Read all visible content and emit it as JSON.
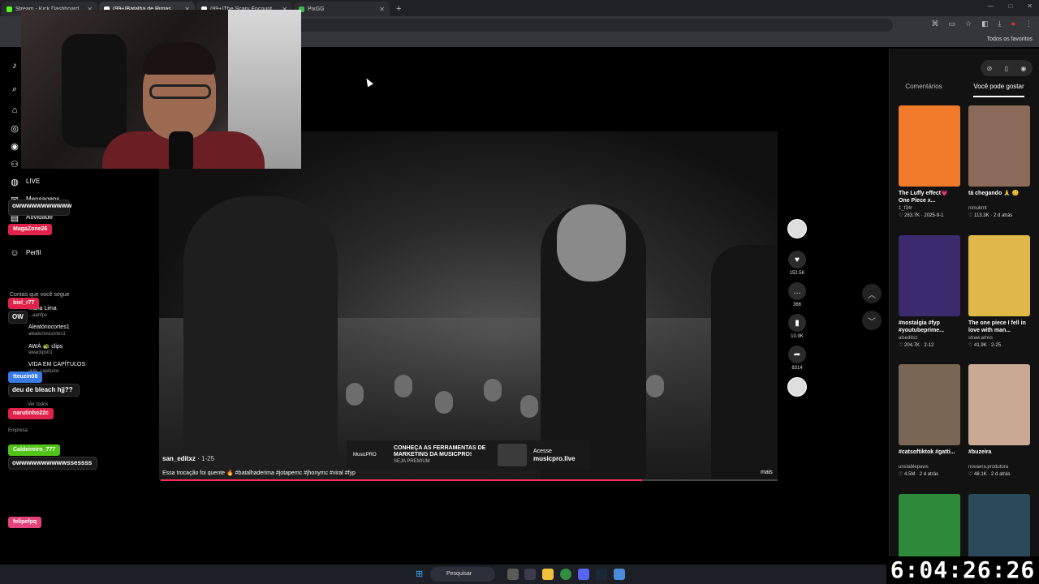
{
  "browser": {
    "tabs": [
      {
        "label": "Stream - Kick Dashboard",
        "color": "#53fc18"
      },
      {
        "label": "(99+)Batalha de Rimas Qu...",
        "color": "#ffffff"
      },
      {
        "label": "(99+)The Scary Encounter with...",
        "color": "#ffffff"
      },
      {
        "label": "PixGG",
        "color": "#3fb950"
      }
    ],
    "new_tab": "+",
    "bookmarks_all": "Todos os favoritos"
  },
  "nav": {
    "live": "LIVE",
    "mensagens": "Mensagens",
    "atividade": "Atividade",
    "perfil": "Perfil",
    "following_header": "Contas que você segue",
    "following": [
      {
        "name": "...ana Lima",
        "handle": "...aanfps"
      },
      {
        "name": "Aleatóriocortes1",
        "handle": "aleatorioscortes1"
      },
      {
        "name": "AWÁ 🐢 clips",
        "handle": "awaclips01"
      },
      {
        "name": "VIDA EM CAPÍTULOS",
        "handle": "vida_capitulos"
      }
    ],
    "see_all": "Ver todos",
    "empresa": "Empresa"
  },
  "chat": [
    {
      "user": "MagaZone26",
      "color": "#e0224a"
    },
    {
      "user": "biel_r77",
      "color": "#e0224a"
    },
    {
      "user": "tteuzin08",
      "color": "#3a7be8"
    },
    {
      "user": "narutinho22c",
      "color": "#e0224a"
    },
    {
      "user": "Caldeireiro_777",
      "color": "#53c41a"
    },
    {
      "user": "felipefpq",
      "color": "#e0447a"
    }
  ],
  "chat_messages": {
    "m1": "owwwwwwwwwww",
    "m2": "OW",
    "m3": "deu de bleach hjj??",
    "m4": "owwwwwwwwwwssessss"
  },
  "video": {
    "author": "san_editxz",
    "date": "1-25",
    "caption": "Essa trocação foi quente 🔥 #batalhaderima #jotapemc #jhonymc #viral #fyp",
    "more": "mais",
    "progress": 0.78,
    "ad": {
      "brand": "MusicPRO",
      "headline": "CONHEÇA AS FERRAMENTAS DE MARKETING DA MUSICPRO!",
      "sub": "SEJA PREMIUM",
      "cta_line1": "Acesse",
      "cta_line2": "musicpro.live"
    }
  },
  "actions": {
    "likes": "152.5K",
    "comments": "366",
    "saves": "10.9K",
    "shares": "8314"
  },
  "panel": {
    "tab_comments": "Comentários",
    "tab_like": "Você pode gostar",
    "cards": [
      {
        "title": "The Luffy effect💗 One Piece x...",
        "author": "1_f34r",
        "meta": "♡ 283.7K · 2025-9-1",
        "color": "#f07a2a"
      },
      {
        "title": "tá chegando 🙏 😊",
        "author": "nimukmt",
        "meta": "♡ 113.3K · 2 d atrás",
        "color": "#8a6a58"
      },
      {
        "title": "#nostalgia #fyp #youtubeprime...",
        "author": "alseditsz",
        "meta": "♡ 204.7K · 2-12",
        "color": "#3b2a6e"
      },
      {
        "title": "The one piece I fell in love with man...",
        "author": "straw.amvs",
        "meta": "♡ 41.9K · 2-25",
        "color": "#e0b84a"
      },
      {
        "title": "#catsoftiktok #gatti...",
        "author": "unstablepaws",
        "meta": "♡ 4.5M · 2 d atrás",
        "color": "#7a6654"
      },
      {
        "title": "#buzeira",
        "author": "novaera.produtora",
        "meta": "♡ 48.1K · 2 d atrás",
        "color": "#c9a894"
      },
      {
        "title": "",
        "author": "",
        "meta": "",
        "color": "#2e8a3a"
      },
      {
        "title": "",
        "author": "",
        "meta": "",
        "color": "#2a4a5a"
      }
    ]
  },
  "taskbar": {
    "search": "Pesquisar"
  },
  "timer": "6:04:26:26"
}
